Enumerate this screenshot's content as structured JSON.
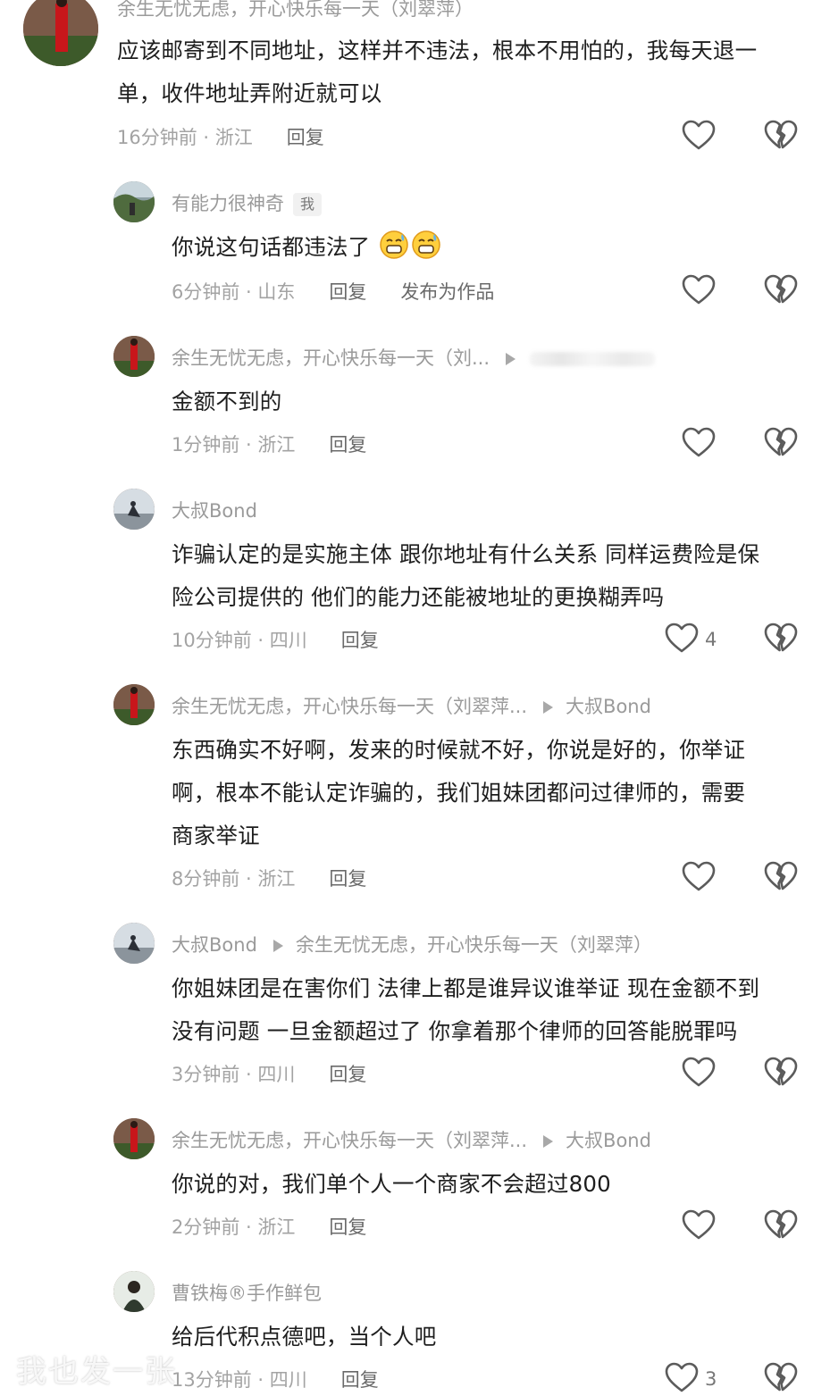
{
  "comments": [
    {
      "name": "余生无忧无虑，开心快乐每一天（刘翠萍）",
      "text_lines": [
        "应该邮寄到不同地址，这样并不违法，根本不用怕的，我每天退一",
        "单，收件地址弄附近就可以"
      ],
      "time": "16分钟前 · 浙江",
      "reply": "回复"
    },
    {
      "name": "有能力很神奇",
      "tag": "我",
      "text_lines": [
        "你说这句话都违法了"
      ],
      "time": "6分钟前 · 山东",
      "reply": "回复",
      "extra_action": "发布为作品"
    },
    {
      "name": "余生无忧无虑，开心快乐每一天（刘...",
      "text_lines": [
        "金额不到的"
      ],
      "time": "1分钟前 · 浙江",
      "reply": "回复"
    },
    {
      "name": "大叔Bond",
      "text_lines": [
        "诈骗认定的是实施主体 跟你地址有什么关系 同样运费险是保",
        "险公司提供的 他们的能力还能被地址的更换糊弄吗"
      ],
      "time": "10分钟前 · 四川",
      "reply": "回复",
      "likes": "4"
    },
    {
      "name": "余生无忧无虑，开心快乐每一天（刘翠萍...",
      "reply_to": "大叔Bond",
      "text_lines": [
        "东西确实不好啊，发来的时候就不好，你说是好的，你举证",
        "啊，根本不能认定诈骗的，我们姐妹团都问过律师的，需要",
        "商家举证"
      ],
      "time": "8分钟前 · 浙江",
      "reply": "回复"
    },
    {
      "name": "大叔Bond",
      "reply_to": "余生无忧无虑，开心快乐每一天（刘翠萍）",
      "text_lines": [
        "你姐妹团是在害你们 法律上都是谁异议谁举证 现在金额不到",
        "没有问题 一旦金额超过了 你拿着那个律师的回答能脱罪吗"
      ],
      "time": "3分钟前 · 四川",
      "reply": "回复"
    },
    {
      "name": "余生无忧无虑，开心快乐每一天（刘翠萍...",
      "reply_to": "大叔Bond",
      "text_lines": [
        "你说的对，我们单个人一个商家不会超过800"
      ],
      "time": "2分钟前 · 浙江",
      "reply": "回复"
    },
    {
      "name": "曹铁梅®手作鲜包",
      "text_lines": [
        "给后代积点德吧，当个人吧"
      ],
      "time": "13分钟前 · 四川",
      "reply": "回复",
      "likes": "3"
    }
  ],
  "watermark": "我也发一张",
  "colors": {
    "accent_red": "#d42a1e",
    "meta_gray": "#a3a3a3",
    "icon_gray": "#5b5b5b"
  }
}
